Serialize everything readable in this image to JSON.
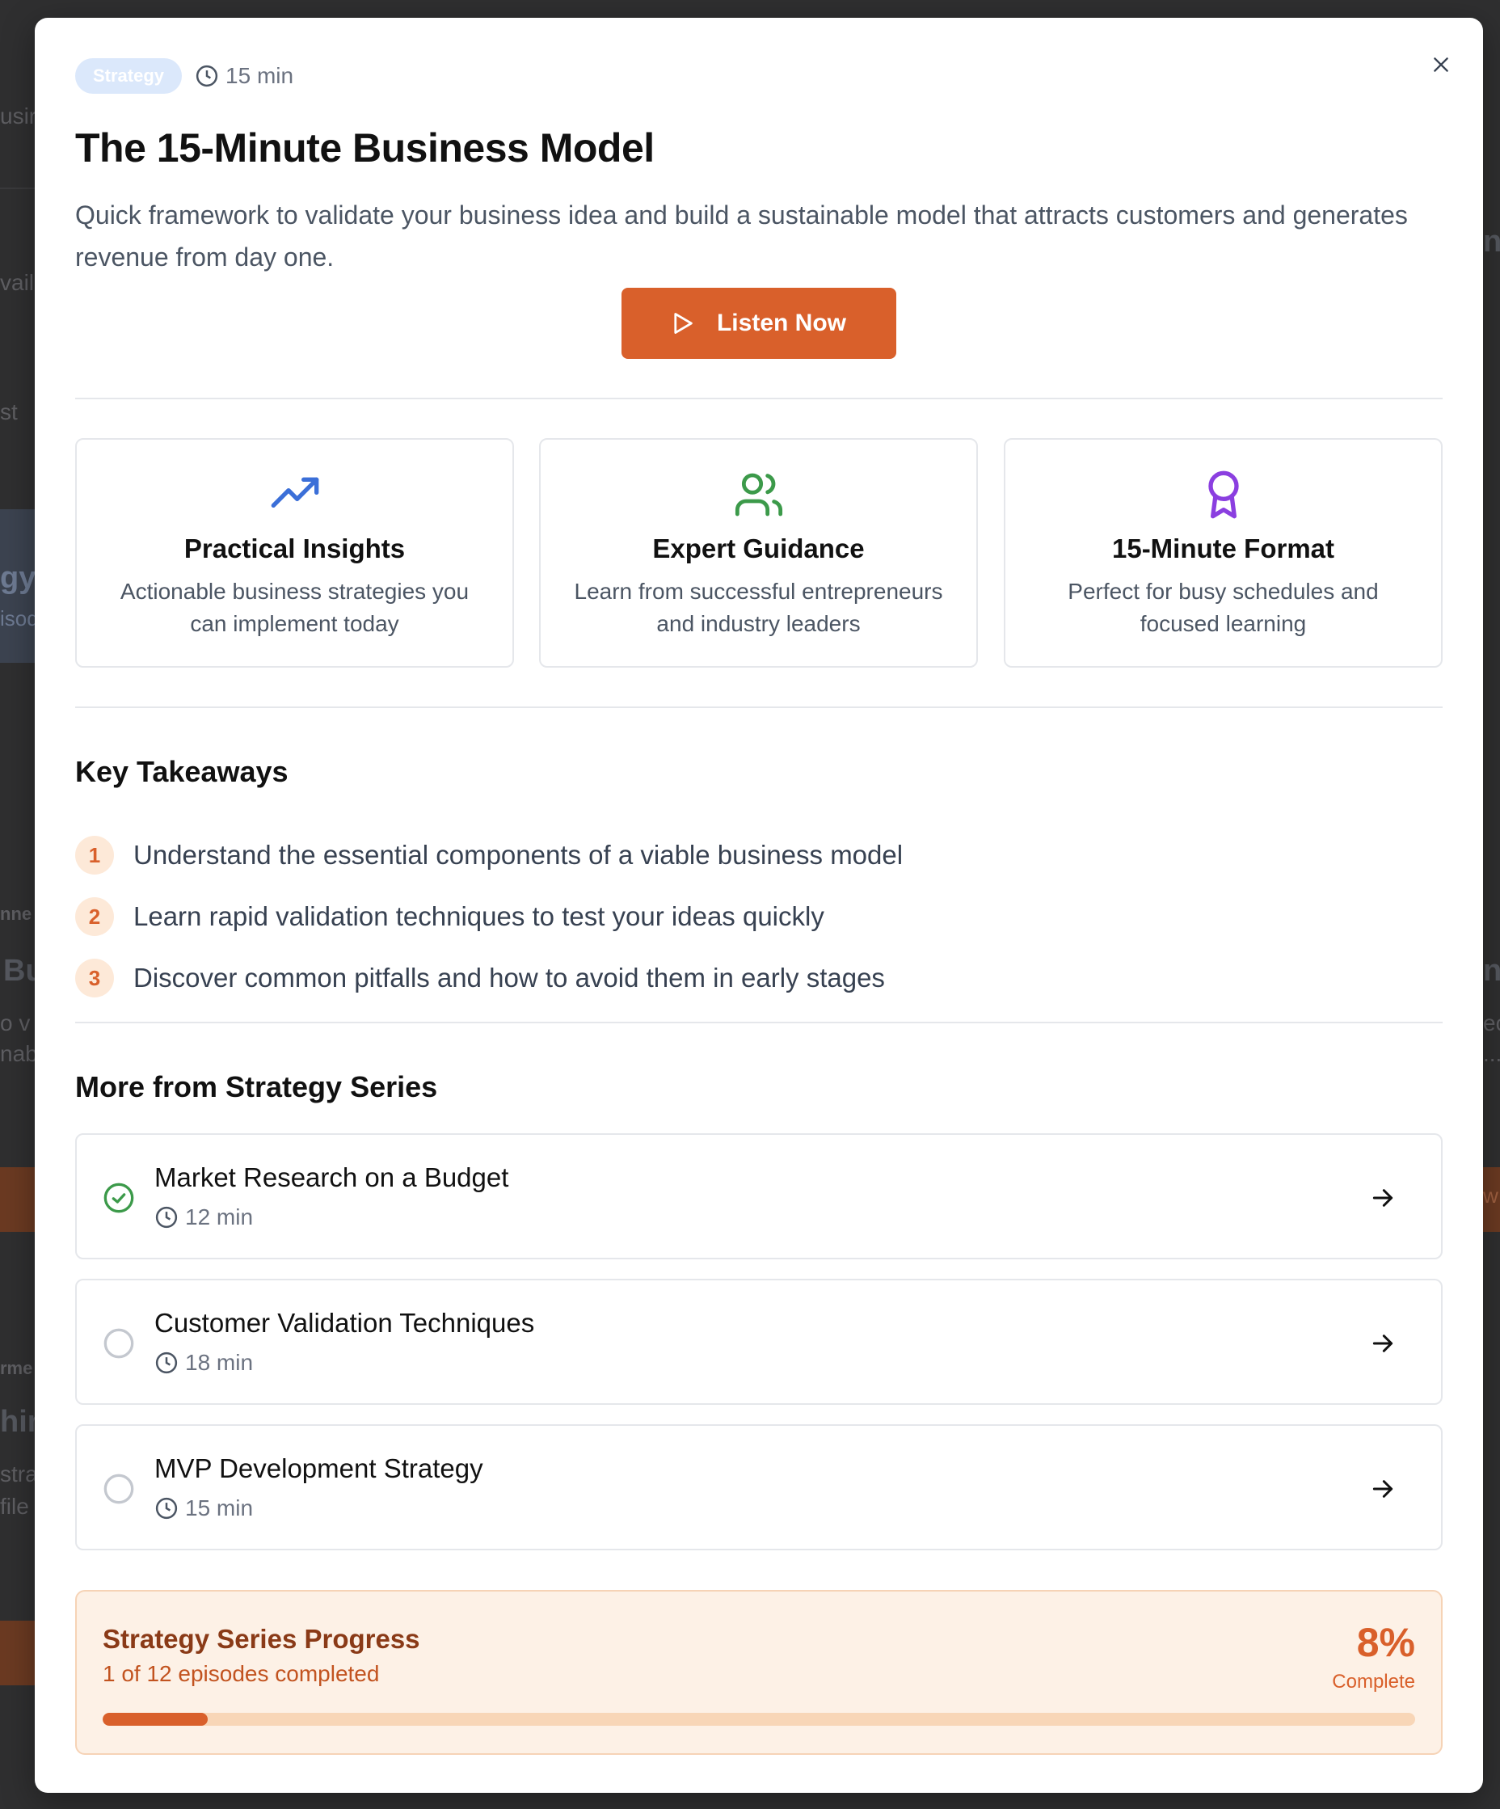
{
  "modal": {
    "badge": "Strategy",
    "duration": "15 min",
    "title": "The 15-Minute Business Model",
    "description": "Quick framework to validate your business idea and build a sustainable model that attracts customers and generates revenue from day one.",
    "listen_label": "Listen Now",
    "close_icon": "close-icon"
  },
  "features": [
    {
      "icon": "trending-up-icon",
      "color": "#3b6fd8",
      "title": "Practical Insights",
      "desc": "Actionable business strategies you can implement today"
    },
    {
      "icon": "users-icon",
      "color": "#3c9a4a",
      "title": "Expert Guidance",
      "desc": "Learn from successful entrepreneurs and industry leaders"
    },
    {
      "icon": "award-icon",
      "color": "#8b3fe0",
      "title": "15-Minute Format",
      "desc": "Perfect for busy schedules and focused learning"
    }
  ],
  "takeaways": {
    "title": "Key Takeaways",
    "items": [
      {
        "num": "1",
        "text": "Understand the essential components of a viable business model"
      },
      {
        "num": "2",
        "text": "Learn rapid validation techniques to test your ideas quickly"
      },
      {
        "num": "3",
        "text": "Discover common pitfalls and how to avoid them in early stages"
      }
    ]
  },
  "series": {
    "title": "More from Strategy Series",
    "episodes": [
      {
        "title": "Market Research on a Budget",
        "duration": "12 min",
        "completed": true
      },
      {
        "title": "Customer Validation Techniques",
        "duration": "18 min",
        "completed": false
      },
      {
        "title": "MVP Development Strategy",
        "duration": "15 min",
        "completed": false
      }
    ]
  },
  "progress": {
    "title": "Strategy Series Progress",
    "subtitle": "1 of 12 episodes completed",
    "percent_label": "8%",
    "complete_label": "Complete",
    "fraction": 0.08,
    "accent": "#d9602b"
  },
  "background_fragments": {
    "frag_1": "usir",
    "frag_2": "vaila",
    "frag_3": "st",
    "frag_4": "gy",
    "frag_5": "isod",
    "frag_6": "nne",
    "frag_7": "Bu",
    "frag_8": "o v",
    "frag_9": "nabl",
    "frag_10": "rme",
    "frag_11": "hing",
    "frag_12": "stra",
    "frag_13": "file",
    "frag_14": "ne",
    "frag_15": "n",
    "frag_16": "ec",
    "frag_17": "...",
    "frag_18": "w"
  }
}
